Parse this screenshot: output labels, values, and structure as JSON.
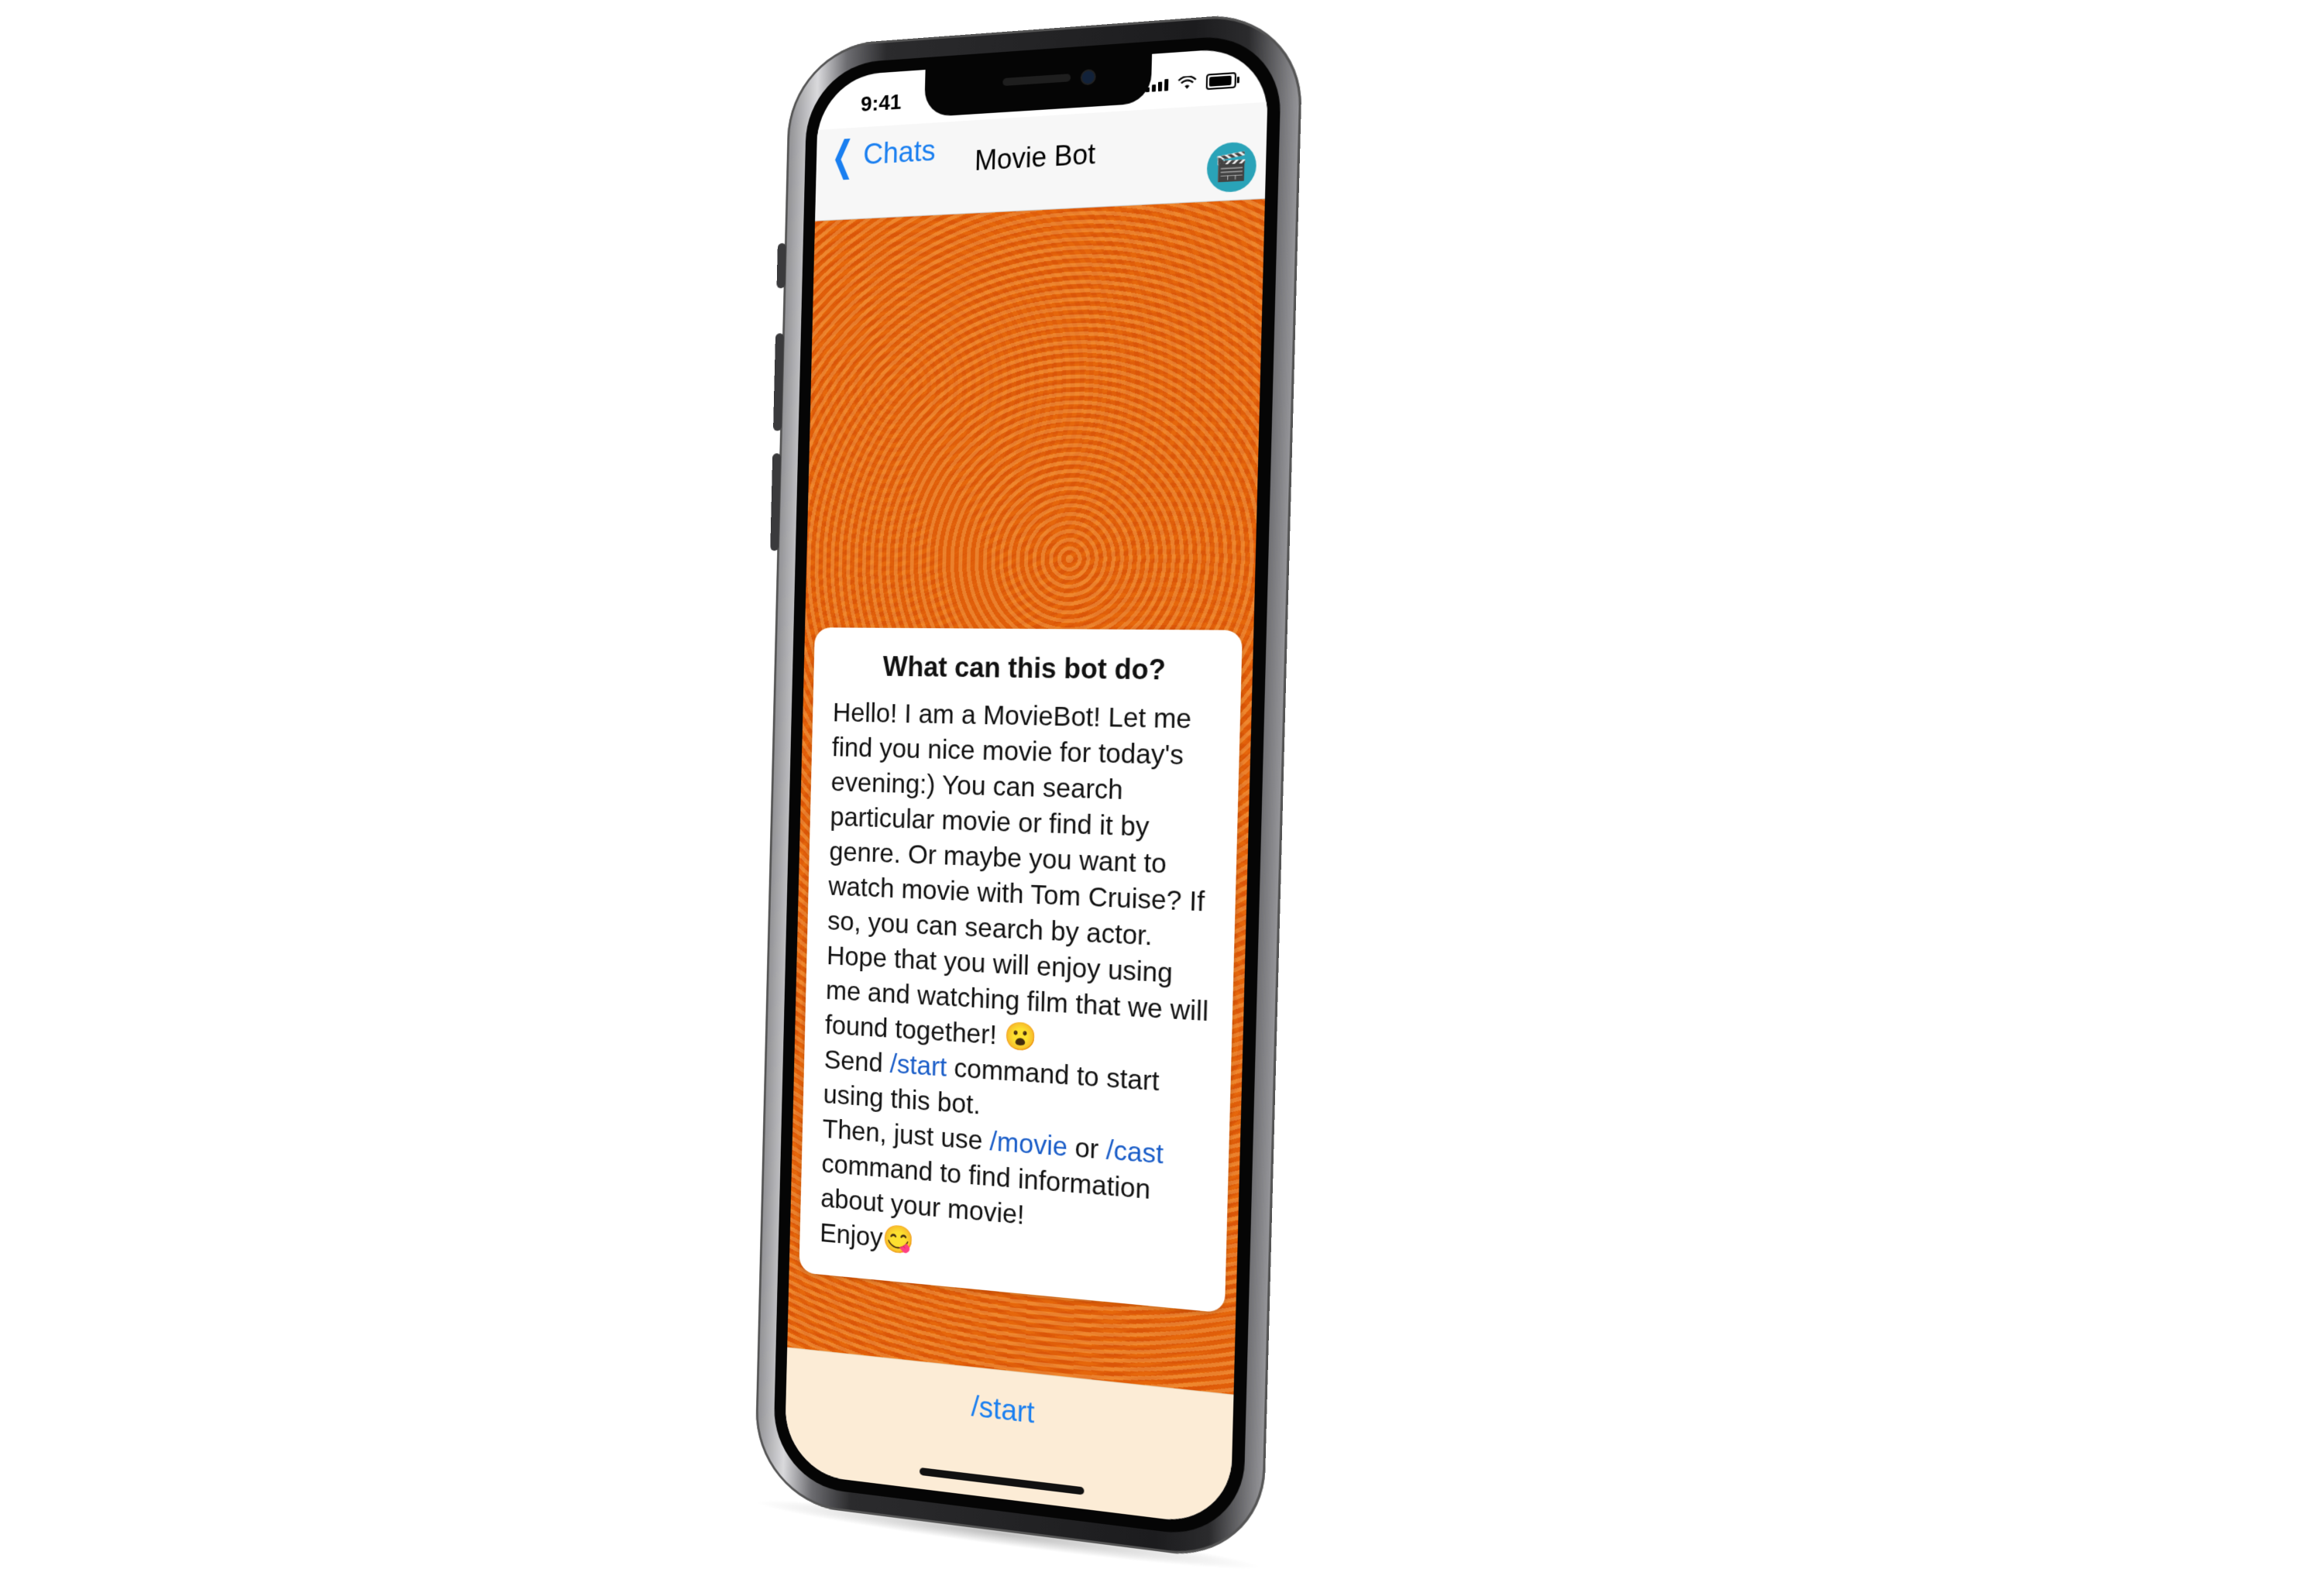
{
  "status_bar": {
    "time": "9:41"
  },
  "nav": {
    "back_label": "Chats",
    "title": "Movie Bot",
    "avatar_emoji": "🎬"
  },
  "intro": {
    "title": "What can this bot do?",
    "paragraph1": "Hello! I am a MovieBot! Let me find you nice movie for today's evening:) You can search particular movie or find it by genre. Or maybe you want to watch movie with Tom Cruise? If so, you can search by actor. Hope that you will enjoy using me and watching film that we will found together!",
    "emoji1": "😮",
    "p2_prefix": "Send ",
    "p2_command": "/start",
    "p2_suffix": " command to start using this bot.",
    "p3_prefix": "Then, just use ",
    "p3_command1": "/movie",
    "p3_or": " or ",
    "p3_command2": "/cast",
    "p3_suffix": " command to find information about your movie!",
    "p4_text": "Enjoy",
    "emoji2": "😋"
  },
  "bottom": {
    "start_button": "/start"
  },
  "colors": {
    "accent": "#1a7ff0",
    "chat_background": "#f5b03c",
    "command_link": "#1a5dc8",
    "bottom_panel": "#fcecd6"
  },
  "icons": {
    "back": "chevron-left-icon",
    "signal": "cellular-signal-icon",
    "wifi": "wifi-icon",
    "battery": "battery-icon"
  }
}
